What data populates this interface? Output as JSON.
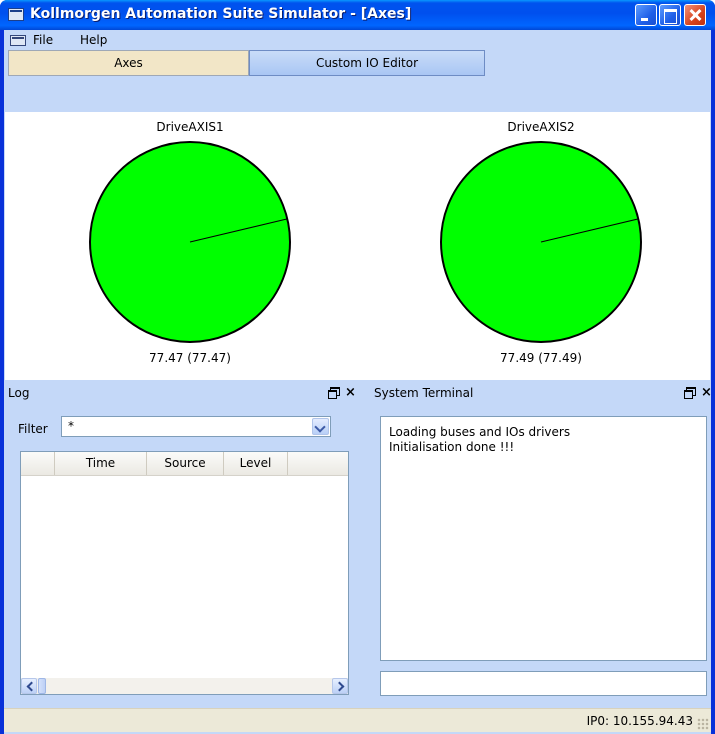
{
  "window": {
    "title": "Kollmorgen Automation Suite Simulator - [Axes]"
  },
  "menu": {
    "items": [
      "File",
      "Help"
    ]
  },
  "tabs": [
    {
      "label": "Axes",
      "active": true
    },
    {
      "label": "Custom IO Editor",
      "active": false
    }
  ],
  "axes": [
    {
      "name": "DriveAXIS1",
      "readout": "77.47 (77.47)",
      "position_deg": 77.47,
      "color": "#00ff00"
    },
    {
      "name": "DriveAXIS2",
      "readout": "77.49 (77.49)",
      "position_deg": 77.49,
      "color": "#00ff00"
    }
  ],
  "log": {
    "title": "Log",
    "filter_label": "Filter",
    "filter_value": "*",
    "columns": [
      "",
      "Time",
      "Source",
      "Level"
    ],
    "rows": []
  },
  "terminal": {
    "title": "System Terminal",
    "lines": [
      "Loading buses and IOs drivers",
      "Initialisation done !!!"
    ],
    "input_value": ""
  },
  "status": {
    "text": "IP0: 10.155.94.43"
  },
  "colors": {
    "titlebar": "#0058ee",
    "client_bg": "#c4d8f8",
    "axis_fill": "#00ff00",
    "active_tab": "#f2e6c7"
  }
}
